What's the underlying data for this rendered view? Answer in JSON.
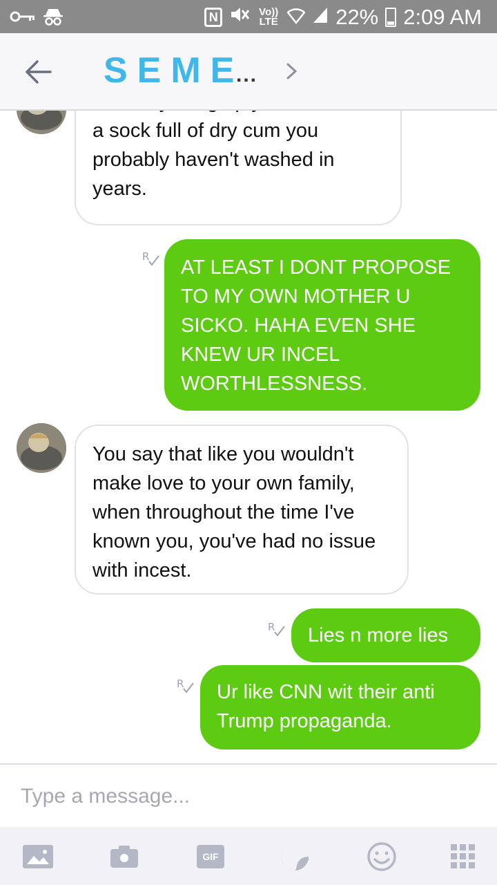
{
  "status_bar": {
    "volte_label": "Vo)) LTE",
    "nfc_label": "N",
    "battery": "22%",
    "time": "2:09 AM"
  },
  "header": {
    "title": "SEME",
    "title_ellipsis": "..."
  },
  "messages": [
    {
      "direction": "in",
      "text": "The only thing up your sleeve is a sock full of dry cum you probably haven't washed in years."
    },
    {
      "direction": "out",
      "text": "AT LEAST I DONT PROPOSE TO MY OWN MOTHER U SICKO. HAHA EVEN SHE KNEW UR INCEL WORTHLESSNESS."
    },
    {
      "direction": "in",
      "text": "You say that like you wouldn't make love to your own family, when throughout the time I've known you, you've had no issue with incest."
    },
    {
      "direction": "out",
      "text": "Lies n more lies"
    },
    {
      "direction": "out",
      "text": "Ur like CNN wit their anti Trump propaganda."
    }
  ],
  "read_receipt": "R",
  "composer": {
    "placeholder": "Type a message..."
  },
  "toolbar": {
    "gif_label": "GIF",
    "icons": [
      "image-icon",
      "camera-icon",
      "gif-icon",
      "sticker-icon",
      "emoji-icon",
      "grid-menu-icon"
    ]
  },
  "colors": {
    "accent_title": "#3fb7e8",
    "outgoing_bubble": "#5ccb12",
    "status_bar": "#8a8a8a",
    "icon_gray": "#b3b7c6"
  }
}
